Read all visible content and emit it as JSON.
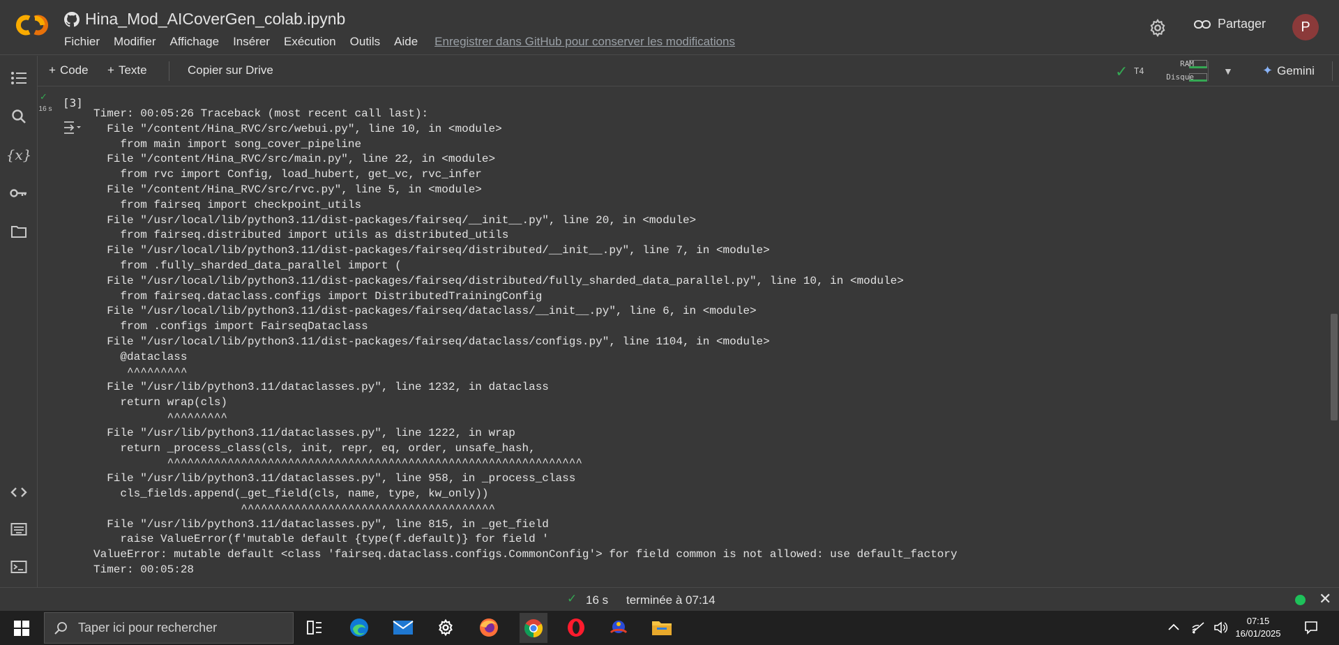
{
  "header": {
    "notebook_title": "Hina_Mod_AICoverGen_colab.ipynb",
    "menu": [
      "Fichier",
      "Modifier",
      "Affichage",
      "Insérer",
      "Exécution",
      "Outils",
      "Aide"
    ],
    "save_link": "Enregistrer dans GitHub pour conserver les modifications",
    "share_label": "Partager",
    "avatar_initial": "P",
    "logo_text": "CO"
  },
  "toolbar": {
    "add_code": "Code",
    "add_text": "Texte",
    "copy_drive": "Copier sur Drive",
    "gpu": "T4",
    "ram_label": "RAM",
    "disk_label": "Disque",
    "gemini": "Gemini"
  },
  "left_rail": [
    "table-of-contents-icon",
    "search-icon",
    "variables-icon",
    "secrets-key-icon",
    "files-folder-icon",
    "code-snippets-icon",
    "command-palette-icon",
    "terminal-icon"
  ],
  "cell": {
    "exec_count": "[3]",
    "duration": "16 s",
    "output_lines": [
      "Timer: 00:05:26 Traceback (most recent call last):",
      "  File \"/content/Hina_RVC/src/webui.py\", line 10, in <module>",
      "    from main import song_cover_pipeline",
      "  File \"/content/Hina_RVC/src/main.py\", line 22, in <module>",
      "    from rvc import Config, load_hubert, get_vc, rvc_infer",
      "  File \"/content/Hina_RVC/src/rvc.py\", line 5, in <module>",
      "    from fairseq import checkpoint_utils",
      "  File \"/usr/local/lib/python3.11/dist-packages/fairseq/__init__.py\", line 20, in <module>",
      "    from fairseq.distributed import utils as distributed_utils",
      "  File \"/usr/local/lib/python3.11/dist-packages/fairseq/distributed/__init__.py\", line 7, in <module>",
      "    from .fully_sharded_data_parallel import (",
      "  File \"/usr/local/lib/python3.11/dist-packages/fairseq/distributed/fully_sharded_data_parallel.py\", line 10, in <module>",
      "    from fairseq.dataclass.configs import DistributedTrainingConfig",
      "  File \"/usr/local/lib/python3.11/dist-packages/fairseq/dataclass/__init__.py\", line 6, in <module>",
      "    from .configs import FairseqDataclass",
      "  File \"/usr/local/lib/python3.11/dist-packages/fairseq/dataclass/configs.py\", line 1104, in <module>",
      "    @dataclass",
      "     ^^^^^^^^^",
      "  File \"/usr/lib/python3.11/dataclasses.py\", line 1232, in dataclass",
      "    return wrap(cls)",
      "           ^^^^^^^^^",
      "  File \"/usr/lib/python3.11/dataclasses.py\", line 1222, in wrap",
      "    return _process_class(cls, init, repr, eq, order, unsafe_hash,",
      "           ^^^^^^^^^^^^^^^^^^^^^^^^^^^^^^^^^^^^^^^^^^^^^^^^^^^^^^^^^^^^^^",
      "  File \"/usr/lib/python3.11/dataclasses.py\", line 958, in _process_class",
      "    cls_fields.append(_get_field(cls, name, type, kw_only))",
      "                      ^^^^^^^^^^^^^^^^^^^^^^^^^^^^^^^^^^^^^^",
      "  File \"/usr/lib/python3.11/dataclasses.py\", line 815, in _get_field",
      "    raise ValueError(f'mutable default {type(f.default)} for field '",
      "ValueError: mutable default <class 'fairseq.dataclass.configs.CommonConfig'> for field common is not allowed: use default_factory",
      "Timer: 00:05:28"
    ]
  },
  "status_bar": {
    "duration": "16 s",
    "finished_text": "terminée à 07:14"
  },
  "taskbar": {
    "search_placeholder": "Taper ici pour rechercher",
    "apps": [
      "task-view-icon",
      "edge-icon",
      "mail-icon",
      "settings-icon",
      "firefox-icon",
      "chrome-icon",
      "opera-icon",
      "app-icon",
      "file-explorer-icon"
    ],
    "time": "07:15",
    "date": "16/01/2025"
  },
  "colors": {
    "accent_orange": "#f9ab00",
    "success_green": "#34a853",
    "avatar_bg": "#8b3a3a"
  }
}
